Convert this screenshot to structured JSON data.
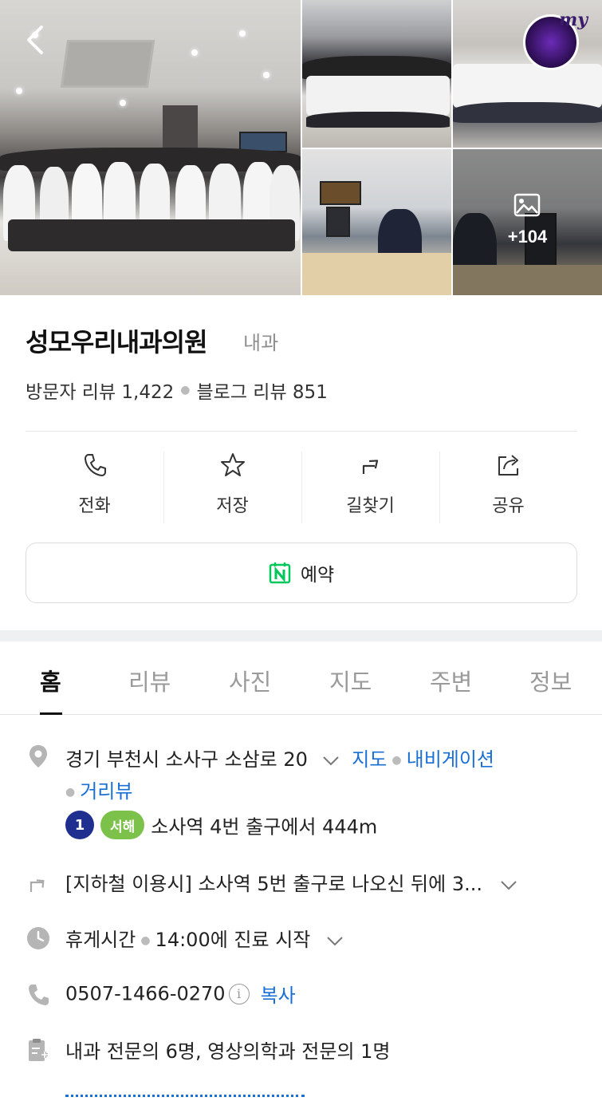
{
  "gallery": {
    "more_count": "+104",
    "badge_text": "my"
  },
  "place": {
    "name": "성모우리내과의원",
    "category": "내과",
    "visitor_reviews": "방문자 리뷰 1,422",
    "blog_reviews": "블로그 리뷰 851"
  },
  "actions": [
    {
      "label": "전화",
      "icon": "phone-icon"
    },
    {
      "label": "저장",
      "icon": "star-icon"
    },
    {
      "label": "길찾기",
      "icon": "directions-icon"
    },
    {
      "label": "공유",
      "icon": "share-icon"
    }
  ],
  "reserve": {
    "label": "예약",
    "icon": "naver-booking-icon"
  },
  "tabs": [
    "홈",
    "리뷰",
    "사진",
    "지도",
    "주변",
    "정보"
  ],
  "info": {
    "address": "경기 부천시 소사구 소삼로 20",
    "map_link": "지도",
    "navi_link": "내비게이션",
    "street_link": "거리뷰",
    "line1": "1",
    "line2": "서해",
    "station": "소사역 4번 출구에서 444m",
    "directions": "[지하철 이용시] 소사역 5번 출구로 나오신 뒤에 3...",
    "hours_status": "휴게시간",
    "hours_detail": "14:00에 진료 시작",
    "phone": "0507-1466-0270",
    "copy": "복사",
    "doctors": "내과 전문의 6명, 영상의학과 전문의 1명"
  },
  "colors": {
    "link": "#1a6fd4",
    "line1": "#1f2f8f",
    "line2": "#7cc24a",
    "naver_green": "#03c75a"
  }
}
